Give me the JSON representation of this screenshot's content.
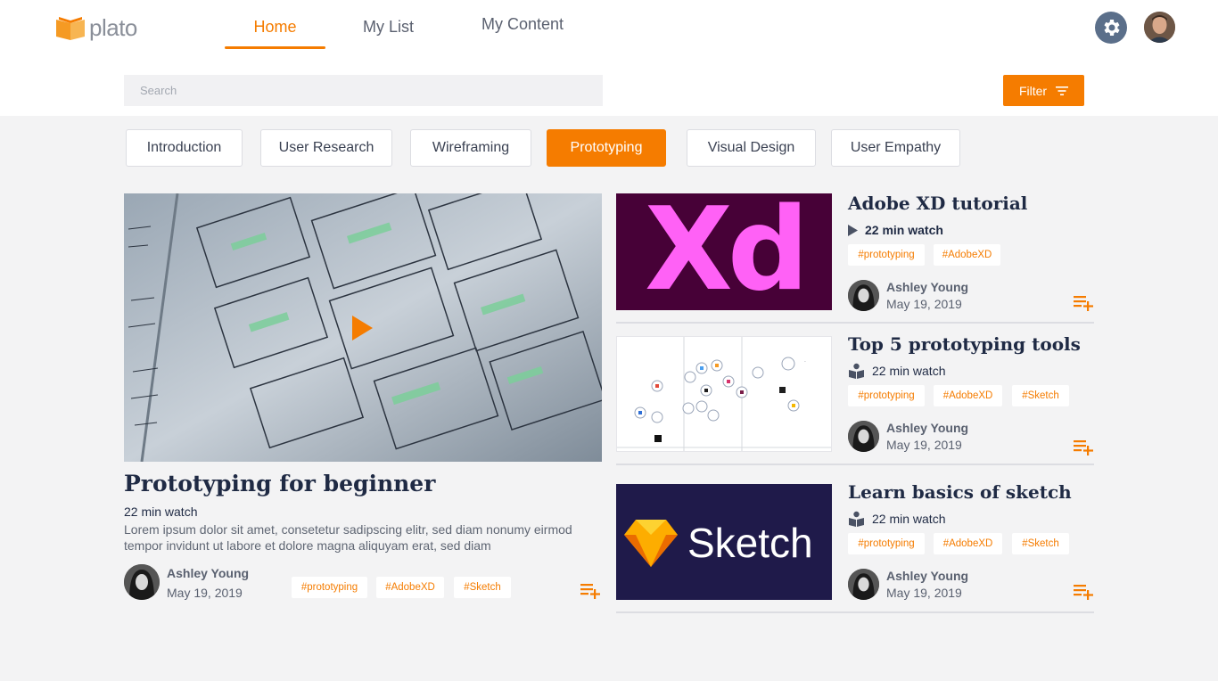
{
  "app": {
    "name": "plato"
  },
  "nav": {
    "home": "Home",
    "my_list": "My List",
    "my_content": "My Content"
  },
  "search": {
    "placeholder": "Search"
  },
  "filter": {
    "label": "Filter"
  },
  "categories": [
    "Introduction",
    "User Research",
    "Wireframing",
    "Prototyping",
    "Visual Design",
    "User Empathy"
  ],
  "active_category": "Prototyping",
  "featured": {
    "title": "Prototyping for beginner",
    "watch": "22 min watch",
    "description_1": "Lorem ipsum dolor sit amet, consetetur sadipscing elitr, sed diam nonumy eirmod",
    "description_2": "tempor invidunt ut labore et dolore magna aliquyam erat, sed diam",
    "author": "Ashley Young",
    "date": "May 19, 2019",
    "tags": [
      "#prototyping",
      "#AdobeXD",
      "#Sketch"
    ]
  },
  "items": [
    {
      "title": "Adobe XD tutorial",
      "watch": "22 min watch",
      "watch_icon": "play-icon",
      "thumb_text": "Xd",
      "author": "Ashley Young",
      "date": "May 19, 2019",
      "tags": [
        "#prototyping",
        "#AdobeXD"
      ]
    },
    {
      "title": "Top 5 prototyping tools",
      "watch": "22 min watch",
      "watch_icon": "book-icon",
      "author": "Ashley Young",
      "date": "May 19, 2019",
      "tags": [
        "#prototyping",
        "#AdobeXD",
        "#Sketch"
      ]
    },
    {
      "title": "Learn basics of sketch",
      "watch": "22 min watch",
      "watch_icon": "book-icon",
      "thumb_text": "Sketch",
      "author": "Ashley Young",
      "date": "May 19, 2019",
      "tags": [
        "#prototyping",
        "#AdobeXD",
        "#Sketch"
      ]
    }
  ],
  "colors": {
    "accent": "#f57c00",
    "navy": "#1f2a44",
    "xd_bg": "#470137",
    "xd_fg": "#ff61f6",
    "sketch_bg": "#1f1a4a"
  }
}
